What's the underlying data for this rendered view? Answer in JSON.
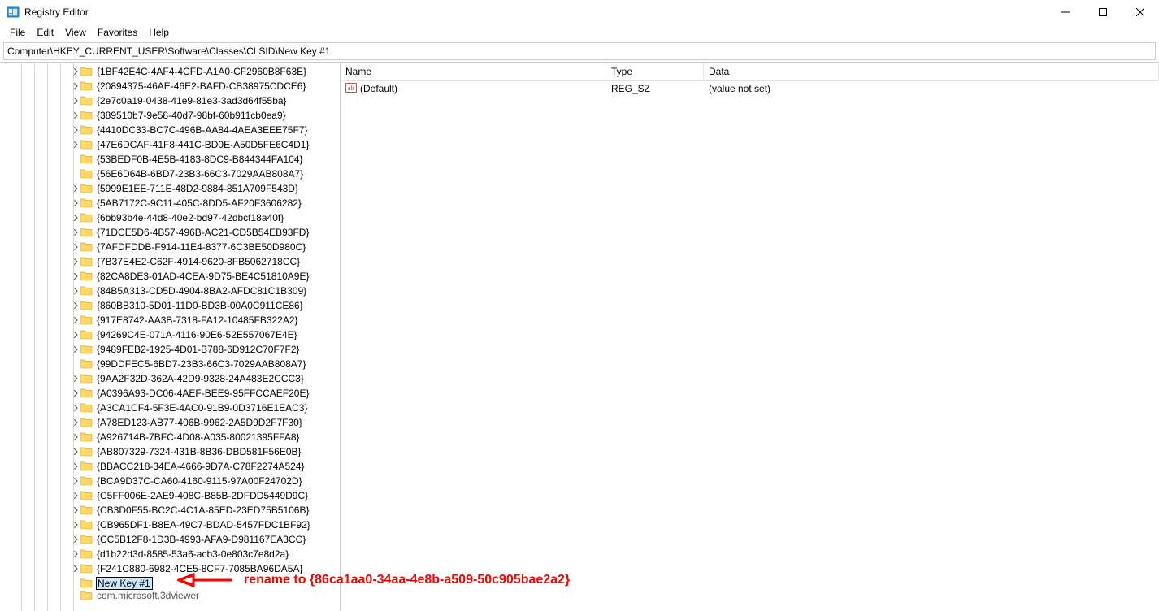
{
  "window": {
    "title": "Registry Editor"
  },
  "menu": {
    "file": "File",
    "edit": "Edit",
    "view": "View",
    "favorites": "Favorites",
    "help": "Help"
  },
  "address": "Computer\\HKEY_CURRENT_USER\\Software\\Classes\\CLSID\\New Key #1",
  "tree": {
    "items": [
      {
        "label": "{1BF42E4C-4AF4-4CFD-A1A0-CF2960B8F63E}",
        "exp": true
      },
      {
        "label": "{20894375-46AE-46E2-BAFD-CB38975CDCE6}",
        "exp": true
      },
      {
        "label": "{2e7c0a19-0438-41e9-81e3-3ad3d64f55ba}",
        "exp": true
      },
      {
        "label": "{389510b7-9e58-40d7-98bf-60b911cb0ea9}",
        "exp": true
      },
      {
        "label": "{4410DC33-BC7C-496B-AA84-4AEA3EEE75F7}",
        "exp": true
      },
      {
        "label": "{47E6DCAF-41F8-441C-BD0E-A50D5FE6C4D1}",
        "exp": true
      },
      {
        "label": "{53BEDF0B-4E5B-4183-8DC9-B844344FA104}",
        "exp": false
      },
      {
        "label": "{56E6D64B-6BD7-23B3-66C3-7029AAB808A7}",
        "exp": false
      },
      {
        "label": "{5999E1EE-711E-48D2-9884-851A709F543D}",
        "exp": true
      },
      {
        "label": "{5AB7172C-9C11-405C-8DD5-AF20F3606282}",
        "exp": true
      },
      {
        "label": "{6bb93b4e-44d8-40e2-bd97-42dbcf18a40f}",
        "exp": true
      },
      {
        "label": "{71DCE5D6-4B57-496B-AC21-CD5B54EB93FD}",
        "exp": true
      },
      {
        "label": "{7AFDFDDB-F914-11E4-8377-6C3BE50D980C}",
        "exp": true
      },
      {
        "label": "{7B37E4E2-C62F-4914-9620-8FB5062718CC}",
        "exp": true
      },
      {
        "label": "{82CA8DE3-01AD-4CEA-9D75-BE4C51810A9E}",
        "exp": true
      },
      {
        "label": "{84B5A313-CD5D-4904-8BA2-AFDC81C1B309}",
        "exp": true
      },
      {
        "label": "{860BB310-5D01-11D0-BD3B-00A0C911CE86}",
        "exp": true
      },
      {
        "label": "{917E8742-AA3B-7318-FA12-10485FB322A2}",
        "exp": true
      },
      {
        "label": "{94269C4E-071A-4116-90E6-52E557067E4E}",
        "exp": true
      },
      {
        "label": "{9489FEB2-1925-4D01-B788-6D912C70F7F2}",
        "exp": true
      },
      {
        "label": "{99DDFEC5-6BD7-23B3-66C3-7029AAB808A7}",
        "exp": false
      },
      {
        "label": "{9AA2F32D-362A-42D9-9328-24A483E2CCC3}",
        "exp": true
      },
      {
        "label": "{A0396A93-DC06-4AEF-BEE9-95FFCCAEF20E}",
        "exp": true
      },
      {
        "label": "{A3CA1CF4-5F3E-4AC0-91B9-0D3716E1EAC3}",
        "exp": true
      },
      {
        "label": "{A78ED123-AB77-406B-9962-2A5D9D2F7F30}",
        "exp": true
      },
      {
        "label": "{A926714B-7BFC-4D08-A035-80021395FFA8}",
        "exp": true
      },
      {
        "label": "{AB807329-7324-431B-8B36-DBD581F56E0B}",
        "exp": true
      },
      {
        "label": "{BBACC218-34EA-4666-9D7A-C78F2274A524}",
        "exp": true
      },
      {
        "label": "{BCA9D37C-CA60-4160-9115-97A00F24702D}",
        "exp": true
      },
      {
        "label": "{C5FF006E-2AE9-408C-B85B-2DFDD5449D9C}",
        "exp": true
      },
      {
        "label": "{CB3D0F55-BC2C-4C1A-85ED-23ED75B5106B}",
        "exp": true
      },
      {
        "label": "{CB965DF1-B8EA-49C7-BDAD-5457FDC1BF92}",
        "exp": true
      },
      {
        "label": "{CC5B12F8-1D3B-4993-AFA9-D981167EA3CC}",
        "exp": true
      },
      {
        "label": "{d1b22d3d-8585-53a6-acb3-0e803c7e8d2a}",
        "exp": true
      },
      {
        "label": "{F241C880-6982-4CE5-8CF7-7085BA96DA5A}",
        "exp": true
      }
    ],
    "editing_item": "New Key #1",
    "truncated_item": "com.microsoft.3dviewer"
  },
  "list": {
    "columns": {
      "name": "Name",
      "type": "Type",
      "data": "Data"
    },
    "rows": [
      {
        "name": "(Default)",
        "type": "REG_SZ",
        "data": "(value not set)"
      }
    ]
  },
  "annotation": {
    "text": "rename to {86ca1aa0-34aa-4e8b-a509-50c905bae2a2}"
  }
}
